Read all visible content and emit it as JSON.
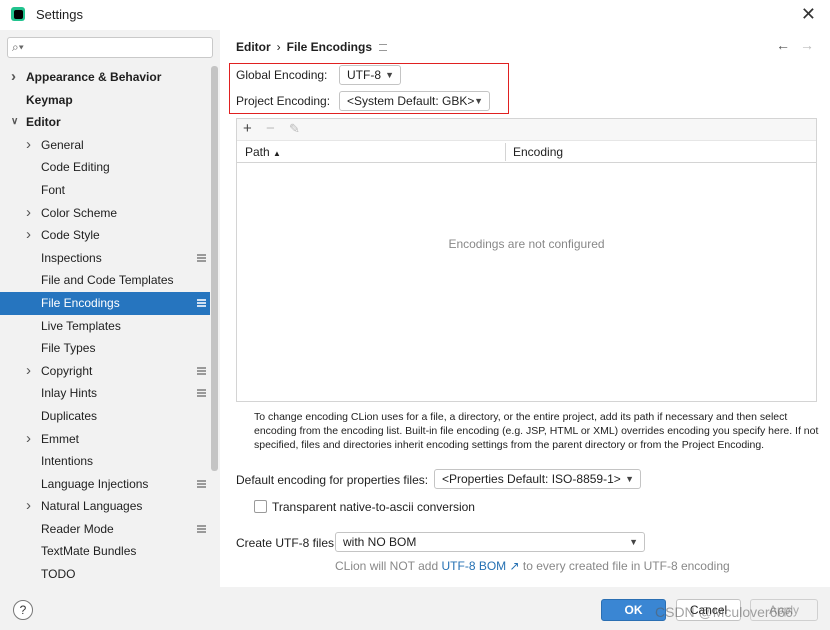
{
  "window": {
    "title": "Settings"
  },
  "sidebar": {
    "search": {
      "placeholder": ""
    },
    "items": [
      {
        "label": "Appearance & Behavior",
        "bold": true,
        "indent": 0,
        "chevron": "right"
      },
      {
        "label": "Keymap",
        "bold": true,
        "indent": 0,
        "chevron": ""
      },
      {
        "label": "Editor",
        "bold": true,
        "indent": 0,
        "chevron": "down"
      },
      {
        "label": "General",
        "indent": 1,
        "chevron": "right"
      },
      {
        "label": "Code Editing",
        "indent": 1,
        "chevron": ""
      },
      {
        "label": "Font",
        "indent": 1,
        "chevron": ""
      },
      {
        "label": "Color Scheme",
        "indent": 1,
        "chevron": "right"
      },
      {
        "label": "Code Style",
        "indent": 1,
        "chevron": "right"
      },
      {
        "label": "Inspections",
        "indent": 1,
        "chevron": "",
        "badge": true
      },
      {
        "label": "File and Code Templates",
        "indent": 1,
        "chevron": ""
      },
      {
        "label": "File Encodings",
        "indent": 1,
        "chevron": "",
        "badge": true,
        "selected": true
      },
      {
        "label": "Live Templates",
        "indent": 1,
        "chevron": ""
      },
      {
        "label": "File Types",
        "indent": 1,
        "chevron": ""
      },
      {
        "label": "Copyright",
        "indent": 1,
        "chevron": "right",
        "badge": true
      },
      {
        "label": "Inlay Hints",
        "indent": 1,
        "chevron": "",
        "badge": true
      },
      {
        "label": "Duplicates",
        "indent": 1,
        "chevron": ""
      },
      {
        "label": "Emmet",
        "indent": 1,
        "chevron": "right"
      },
      {
        "label": "Intentions",
        "indent": 1,
        "chevron": ""
      },
      {
        "label": "Language Injections",
        "indent": 1,
        "chevron": "",
        "badge": true
      },
      {
        "label": "Natural Languages",
        "indent": 1,
        "chevron": "right"
      },
      {
        "label": "Reader Mode",
        "indent": 1,
        "chevron": "",
        "badge": true
      },
      {
        "label": "TextMate Bundles",
        "indent": 1,
        "chevron": ""
      },
      {
        "label": "TODO",
        "indent": 1,
        "chevron": ""
      }
    ]
  },
  "main": {
    "breadcrumb": {
      "parent": "Editor",
      "separator": "›",
      "current": "File Encodings"
    },
    "global_encoding": {
      "label": "Global Encoding:",
      "value": "UTF-8"
    },
    "project_encoding": {
      "label": "Project Encoding:",
      "value": "<System Default: GBK>"
    },
    "table": {
      "add": "+",
      "remove": "−",
      "edit": "✎",
      "col_path": "Path",
      "sort_indicator": "▲",
      "col_encoding": "Encoding",
      "empty": "Encodings are not configured"
    },
    "help_text": "To change encoding CLion uses for a file, a directory, or the entire project, add its path if necessary and then select encoding from the encoding list. Built-in file encoding (e.g. JSP, HTML or XML) overrides encoding you specify here. If not specified, files and directories inherit encoding settings from the parent directory or from the Project Encoding.",
    "properties_encoding": {
      "label": "Default encoding for properties files:",
      "value": "<Properties Default: ISO-8859-1>"
    },
    "transparent": {
      "label": "Transparent native-to-ascii conversion",
      "checked": false
    },
    "create_utf8": {
      "label": "Create UTF-8 files:",
      "value": "with NO BOM"
    },
    "note": {
      "prefix": "CLion will NOT add",
      "link": "UTF-8 BOM ↗",
      "suffix": "to every created file in UTF-8 encoding"
    }
  },
  "footer": {
    "help": "?",
    "ok": "OK",
    "cancel": "Cancel",
    "apply": "Apply",
    "watermark": "CSDN @Mculover666"
  },
  "colors": {
    "selection": "#2675bf",
    "highlight_border": "#e02020",
    "link": "#2470b3",
    "ok_button": "#3a86d3"
  }
}
